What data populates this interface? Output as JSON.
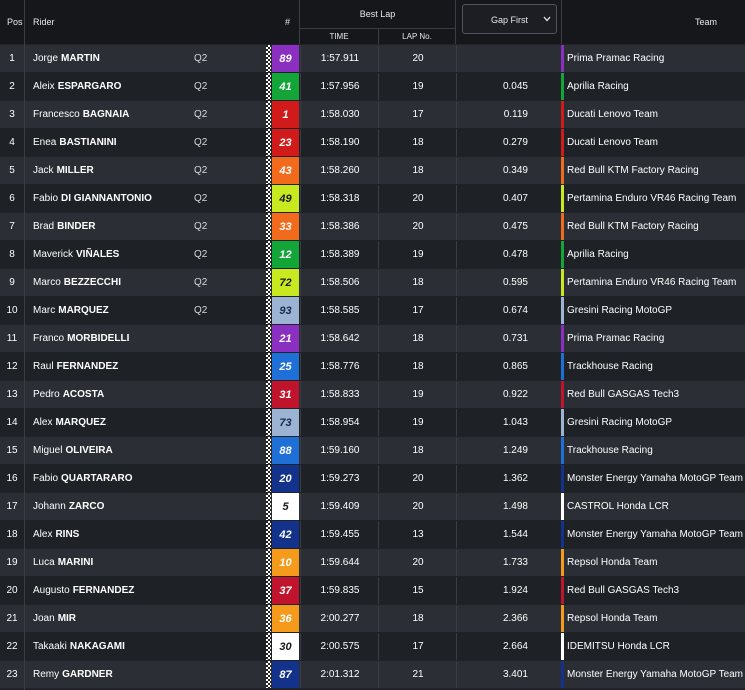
{
  "header": {
    "pos": "Pos",
    "rider": "Rider",
    "num": "#",
    "best_lap": "Best Lap",
    "time": "TIME",
    "lap_no": "LAP No.",
    "gap_first": "Gap First",
    "team": "Team"
  },
  "rows": [
    {
      "pos": "1",
      "first": "Jorge",
      "last": "MARTIN",
      "q": "Q2",
      "num": "89",
      "numColor": "#8a2fbf",
      "numText": "#ffffff",
      "time": "1:57.911",
      "lap": "20",
      "gap": "",
      "teamColor": "#8a2fbf",
      "team": "Prima Pramac Racing"
    },
    {
      "pos": "2",
      "first": "Aleix",
      "last": "ESPARGARO",
      "q": "Q2",
      "num": "41",
      "numColor": "#13a538",
      "numText": "#ffffff",
      "time": "1:57.956",
      "lap": "19",
      "gap": "0.045",
      "teamColor": "#13a538",
      "team": "Aprilia Racing"
    },
    {
      "pos": "3",
      "first": "Francesco",
      "last": "BAGNAIA",
      "q": "Q2",
      "num": "1",
      "numColor": "#d11a1a",
      "numText": "#ffffff",
      "time": "1:58.030",
      "lap": "17",
      "gap": "0.119",
      "teamColor": "#d11a1a",
      "team": "Ducati Lenovo Team"
    },
    {
      "pos": "4",
      "first": "Enea",
      "last": "BASTIANINI",
      "q": "Q2",
      "num": "23",
      "numColor": "#d11a1a",
      "numText": "#ffffff",
      "time": "1:58.190",
      "lap": "18",
      "gap": "0.279",
      "teamColor": "#d11a1a",
      "team": "Ducati Lenovo Team"
    },
    {
      "pos": "5",
      "first": "Jack",
      "last": "MILLER",
      "q": "Q2",
      "num": "43",
      "numColor": "#f26a1b",
      "numText": "#ffffff",
      "time": "1:58.260",
      "lap": "18",
      "gap": "0.349",
      "teamColor": "#f26a1b",
      "team": "Red Bull KTM Factory Racing"
    },
    {
      "pos": "6",
      "first": "Fabio",
      "last": "DI GIANNANTONIO",
      "q": "Q2",
      "num": "49",
      "numColor": "#c8e820",
      "numText": "#1a1a1a",
      "time": "1:58.318",
      "lap": "20",
      "gap": "0.407",
      "teamColor": "#c8e820",
      "team": "Pertamina Enduro VR46 Racing Team"
    },
    {
      "pos": "7",
      "first": "Brad",
      "last": "BINDER",
      "q": "Q2",
      "num": "33",
      "numColor": "#f26a1b",
      "numText": "#ffffff",
      "time": "1:58.386",
      "lap": "20",
      "gap": "0.475",
      "teamColor": "#f26a1b",
      "team": "Red Bull KTM Factory Racing"
    },
    {
      "pos": "8",
      "first": "Maverick",
      "last": "VIÑALES",
      "q": "Q2",
      "num": "12",
      "numColor": "#13a538",
      "numText": "#ffffff",
      "time": "1:58.389",
      "lap": "19",
      "gap": "0.478",
      "teamColor": "#13a538",
      "team": "Aprilia Racing"
    },
    {
      "pos": "9",
      "first": "Marco",
      "last": "BEZZECCHI",
      "q": "Q2",
      "num": "72",
      "numColor": "#c8e820",
      "numText": "#1a1a1a",
      "time": "1:58.506",
      "lap": "18",
      "gap": "0.595",
      "teamColor": "#c8e820",
      "team": "Pertamina Enduro VR46 Racing Team"
    },
    {
      "pos": "10",
      "first": "Marc",
      "last": "MARQUEZ",
      "q": "Q2",
      "num": "93",
      "numColor": "#9db3d4",
      "numText": "#1a2a50",
      "time": "1:58.585",
      "lap": "17",
      "gap": "0.674",
      "teamColor": "#9db3d4",
      "team": "Gresini Racing MotoGP"
    },
    {
      "pos": "11",
      "first": "Franco",
      "last": "MORBIDELLI",
      "q": "",
      "num": "21",
      "numColor": "#8a2fbf",
      "numText": "#ffffff",
      "time": "1:58.642",
      "lap": "18",
      "gap": "0.731",
      "teamColor": "#8a2fbf",
      "team": "Prima Pramac Racing"
    },
    {
      "pos": "12",
      "first": "Raul",
      "last": "FERNANDEZ",
      "q": "",
      "num": "25",
      "numColor": "#1e6fd6",
      "numText": "#ffffff",
      "time": "1:58.776",
      "lap": "18",
      "gap": "0.865",
      "teamColor": "#1e6fd6",
      "team": "Trackhouse Racing"
    },
    {
      "pos": "13",
      "first": "Pedro",
      "last": "ACOSTA",
      "q": "",
      "num": "31",
      "numColor": "#c0142c",
      "numText": "#ffffff",
      "time": "1:58.833",
      "lap": "19",
      "gap": "0.922",
      "teamColor": "#c0142c",
      "team": "Red Bull GASGAS Tech3"
    },
    {
      "pos": "14",
      "first": "Alex",
      "last": "MARQUEZ",
      "q": "",
      "num": "73",
      "numColor": "#9db3d4",
      "numText": "#1a2a50",
      "time": "1:58.954",
      "lap": "19",
      "gap": "1.043",
      "teamColor": "#9db3d4",
      "team": "Gresini Racing MotoGP"
    },
    {
      "pos": "15",
      "first": "Miguel",
      "last": "OLIVEIRA",
      "q": "",
      "num": "88",
      "numColor": "#1e6fd6",
      "numText": "#ffffff",
      "time": "1:59.160",
      "lap": "18",
      "gap": "1.249",
      "teamColor": "#1e6fd6",
      "team": "Trackhouse Racing"
    },
    {
      "pos": "16",
      "first": "Fabio",
      "last": "QUARTARARO",
      "q": "",
      "num": "20",
      "numColor": "#12328c",
      "numText": "#ffffff",
      "time": "1:59.273",
      "lap": "20",
      "gap": "1.362",
      "teamColor": "#12328c",
      "team": "Monster Energy Yamaha MotoGP Team"
    },
    {
      "pos": "17",
      "first": "Johann",
      "last": "ZARCO",
      "q": "",
      "num": "5",
      "numColor": "#ffffff",
      "numText": "#1a1a1a",
      "time": "1:59.409",
      "lap": "20",
      "gap": "1.498",
      "teamColor": "#ffffff",
      "team": "CASTROL Honda LCR"
    },
    {
      "pos": "18",
      "first": "Alex",
      "last": "RINS",
      "q": "",
      "num": "42",
      "numColor": "#12328c",
      "numText": "#ffffff",
      "time": "1:59.455",
      "lap": "13",
      "gap": "1.544",
      "teamColor": "#12328c",
      "team": "Monster Energy Yamaha MotoGP Team"
    },
    {
      "pos": "19",
      "first": "Luca",
      "last": "MARINI",
      "q": "",
      "num": "10",
      "numColor": "#f59a1b",
      "numText": "#ffffff",
      "time": "1:59.644",
      "lap": "20",
      "gap": "1.733",
      "teamColor": "#f59a1b",
      "team": "Repsol Honda Team"
    },
    {
      "pos": "20",
      "first": "Augusto",
      "last": "FERNANDEZ",
      "q": "",
      "num": "37",
      "numColor": "#c0142c",
      "numText": "#ffffff",
      "time": "1:59.835",
      "lap": "15",
      "gap": "1.924",
      "teamColor": "#c0142c",
      "team": "Red Bull GASGAS Tech3"
    },
    {
      "pos": "21",
      "first": "Joan",
      "last": "MIR",
      "q": "",
      "num": "36",
      "numColor": "#f59a1b",
      "numText": "#ffffff",
      "time": "2:00.277",
      "lap": "18",
      "gap": "2.366",
      "teamColor": "#f59a1b",
      "team": "Repsol Honda Team"
    },
    {
      "pos": "22",
      "first": "Takaaki",
      "last": "NAKAGAMI",
      "q": "",
      "num": "30",
      "numColor": "#ffffff",
      "numText": "#1a1a1a",
      "time": "2:00.575",
      "lap": "17",
      "gap": "2.664",
      "teamColor": "#ffffff",
      "team": "IDEMITSU Honda LCR"
    },
    {
      "pos": "23",
      "first": "Remy",
      "last": "GARDNER",
      "q": "",
      "num": "87",
      "numColor": "#12328c",
      "numText": "#ffffff",
      "time": "2:01.312",
      "lap": "21",
      "gap": "3.401",
      "teamColor": "#12328c",
      "team": "Monster Energy Yamaha MotoGP Team"
    }
  ]
}
